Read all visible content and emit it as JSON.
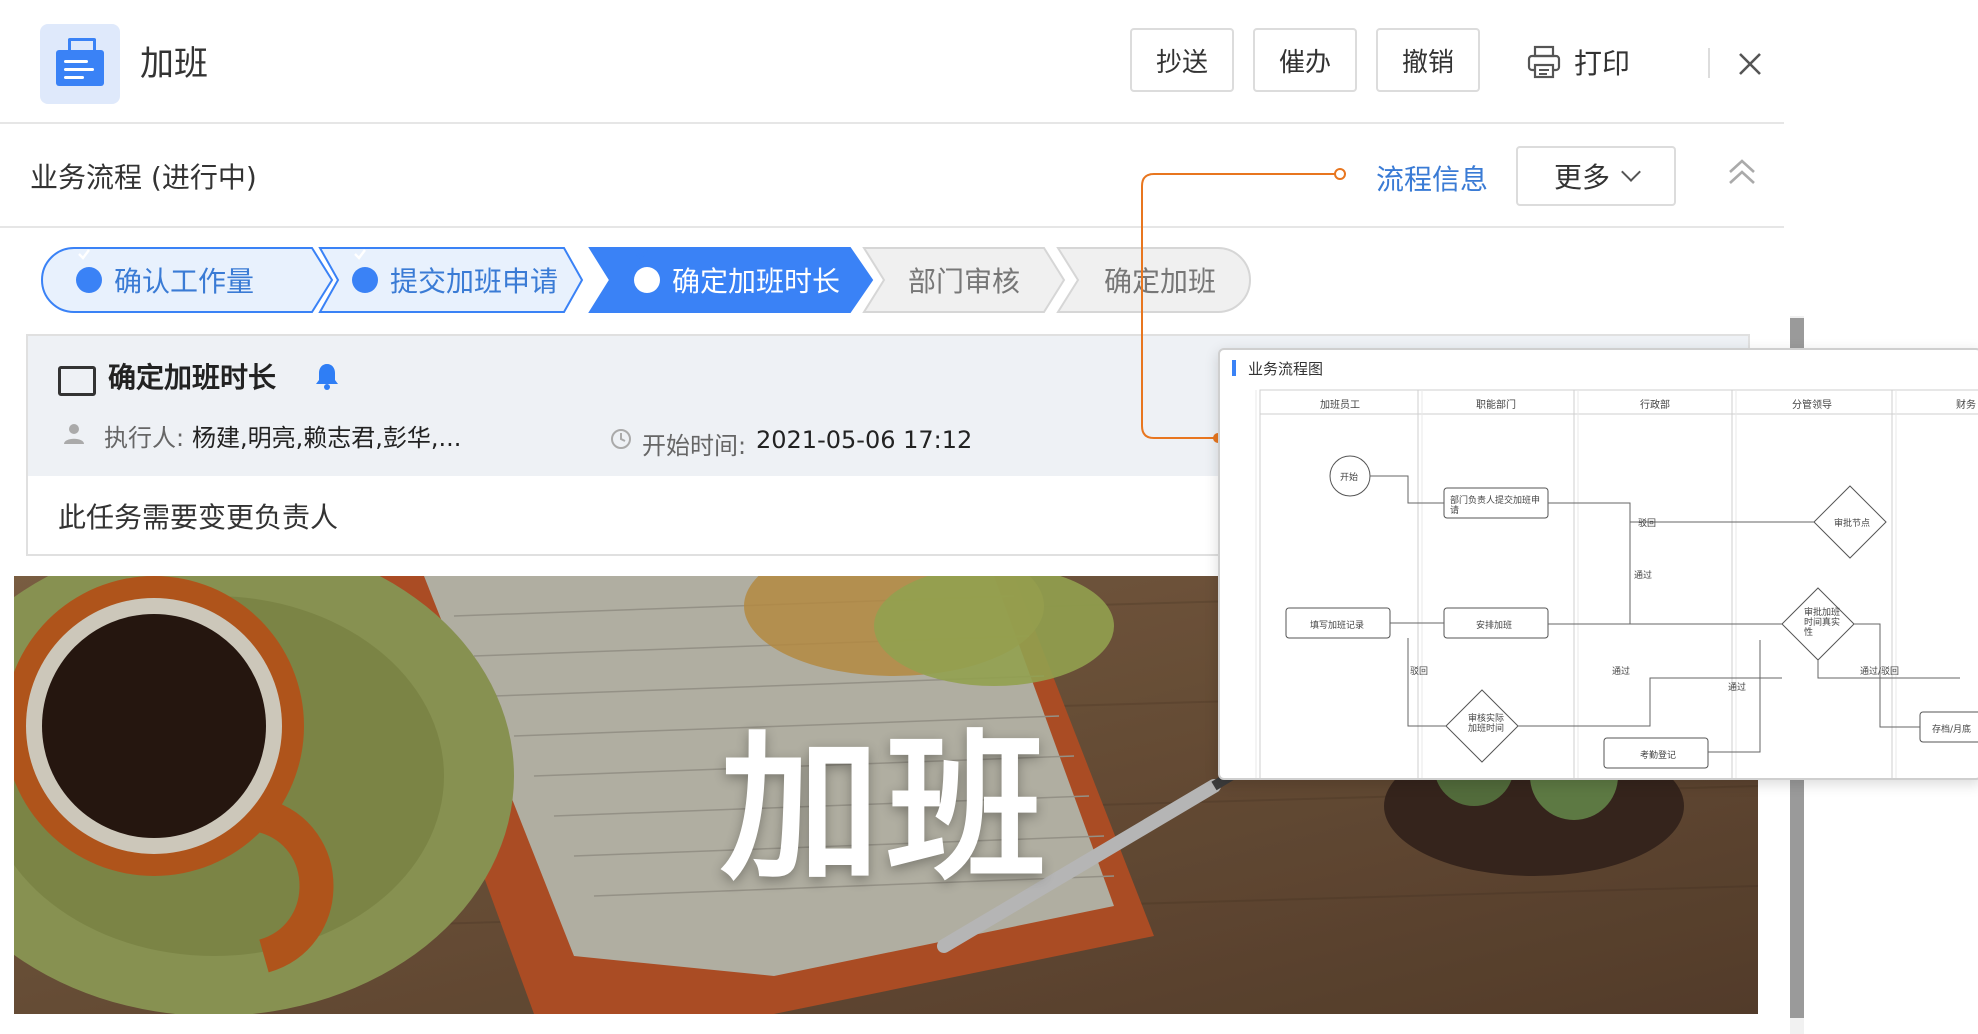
{
  "header": {
    "title": "加班",
    "buttons": {
      "cc": "抄送",
      "urge": "催办",
      "revoke": "撤销",
      "print": "打印"
    }
  },
  "process": {
    "title": "业务流程 (进行中)",
    "flow_info_link": "流程信息",
    "more_label": "更多"
  },
  "steps": [
    {
      "label": "确认工作量",
      "state": "done"
    },
    {
      "label": "提交加班申请",
      "state": "done"
    },
    {
      "label": "确定加班时长",
      "state": "current"
    },
    {
      "label": "部门审核",
      "state": "pending"
    },
    {
      "label": "确定加班",
      "state": "pending"
    }
  ],
  "task": {
    "name": "确定加班时长",
    "assignee_label": "执行人:",
    "assignees": "杨建,明亮,赖志君,彭华,...",
    "start_label": "开始时间:",
    "start_time": "2021-05-06 17:12",
    "note": "此任务需要变更负责人"
  },
  "banner": {
    "title": "加班"
  },
  "flow_popup": {
    "title": "业务流程图",
    "lanes": [
      "加班员工",
      "职能部门",
      "行政部",
      "分管领导",
      "财务"
    ],
    "nodes": {
      "start": "开始",
      "submit": "部门负责人提交加班申请",
      "approve_node": "审批节点",
      "fill_record": "填写加班记录",
      "arrange": "安排加班",
      "verify_authentic": "审批加班时间真实性",
      "review_time": "审核实际加班时间",
      "attendance": "考勤登记",
      "archive": "存档/月底"
    },
    "edge_labels": {
      "reject1": "驳回",
      "pass1": "通过",
      "reject2": "驳回",
      "pass2": "通过",
      "pass3": "通过",
      "pass_reject": "通过/驳回"
    }
  },
  "colors": {
    "accent": "#3a82f6",
    "link": "#3a7bd5",
    "step_done_bg": "#e8f1fd",
    "step_pending_bg": "#f0f0f0",
    "connector": "#e8761f"
  }
}
